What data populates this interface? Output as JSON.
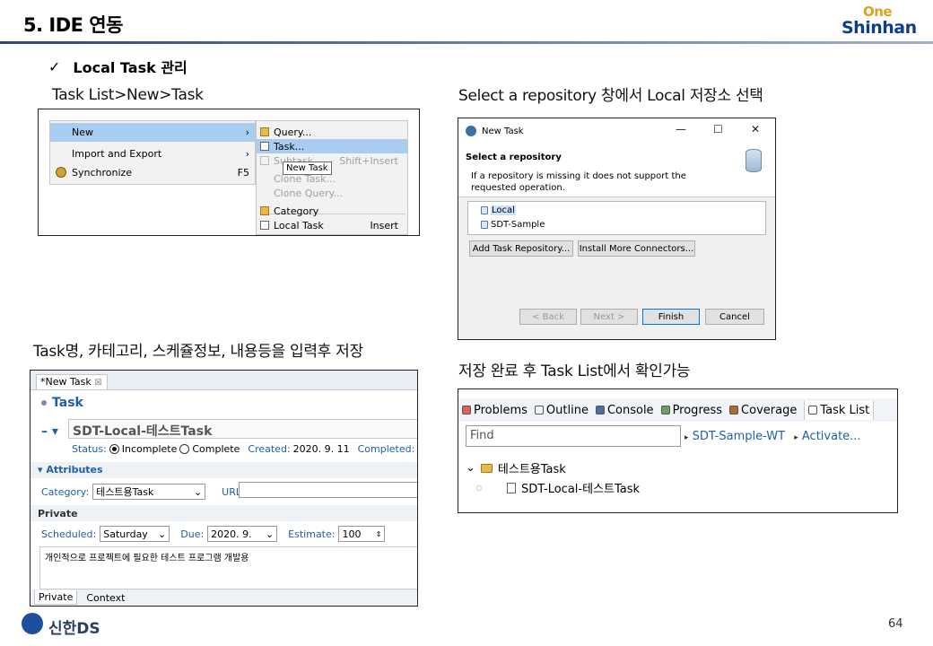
{
  "header": {
    "title": "5. IDE 연동",
    "logo_line1": "One",
    "logo_line2": "Shinhan"
  },
  "check_mark": "✓",
  "section_heading": "Local Task 관리",
  "captions": {
    "step1": "Task List>New>Task",
    "step2": "Select a repository 창에서 Local 저장소 선택",
    "step3": "Task명, 카테고리, 스케쥴정보, 내용등을 입력후 저장",
    "step4": "저장 완료 후 Task List에서 확인가능"
  },
  "context_menu": {
    "items": [
      {
        "label": "New",
        "right": "›"
      },
      {
        "label": "Import and Export",
        "right": "›"
      },
      {
        "label": "Synchronize",
        "right": "F5"
      }
    ],
    "submenu": [
      {
        "label": "Query...",
        "right": ""
      },
      {
        "label": "Task...",
        "right": ""
      },
      {
        "label": "Subtask",
        "right": "Shift+Insert"
      },
      {
        "label": "Clone Task...",
        "right": ""
      },
      {
        "label": "Clone Query...",
        "right": ""
      },
      {
        "label": "Category",
        "right": ""
      },
      {
        "label": "Local Task",
        "right": "Insert"
      }
    ],
    "tooltip": "New Task"
  },
  "dialog": {
    "window_title": "New Task",
    "controls": {
      "minimize": "—",
      "maximize": "☐",
      "close": "✕"
    },
    "heading": "Select a repository",
    "message": "If a repository is missing it does not support the requested operation.",
    "repositories": [
      "Local",
      "SDT-Sample"
    ],
    "buttons": {
      "add": "Add Task Repository...",
      "install": "Install More Connectors...",
      "back": "< Back",
      "next": "Next >",
      "finish": "Finish",
      "cancel": "Cancel"
    }
  },
  "editor": {
    "tab_label": "*New Task",
    "tab_close": "☒",
    "section_title": "Task",
    "summary": "SDT-Local-테스트Task",
    "status_label": "Status:",
    "status_incomplete": "Incomplete",
    "status_complete": "Complete",
    "created_label": "Created:",
    "created_value": "2020. 9. 11",
    "completed_label": "Completed:",
    "completed_value": "-",
    "attributes_title": "Attributes",
    "category_label": "Category:",
    "category_value": "테스트용Task",
    "url_label": "URL:",
    "private_title": "Private",
    "scheduled_label": "Scheduled:",
    "scheduled_value": "Saturday",
    "due_label": "Due:",
    "due_value": "2020. 9.",
    "estimate_label": "Estimate:",
    "estimate_value": "100",
    "notes": "개인적으로 프로젝트에 필요한 테스트 프로그램 개발용",
    "bottom_tabs": [
      "Private",
      "Context"
    ]
  },
  "task_list": {
    "tabs": [
      "Problems",
      "Outline",
      "Console",
      "Progress",
      "Coverage",
      "Task List"
    ],
    "find_placeholder": "Find",
    "repository": "SDT-Sample-WT",
    "activate": "Activate...",
    "category": "테스트용Task",
    "task": "SDT-Local-테스트Task"
  },
  "footer": {
    "logo_text": "신한DS",
    "page_number": "64"
  },
  "colors": {
    "accent_blue": "#1e5fa8",
    "menu_highlight": "#a8cdf0",
    "logo_gold": "#e0a020",
    "logo_navy": "#103c8c"
  }
}
